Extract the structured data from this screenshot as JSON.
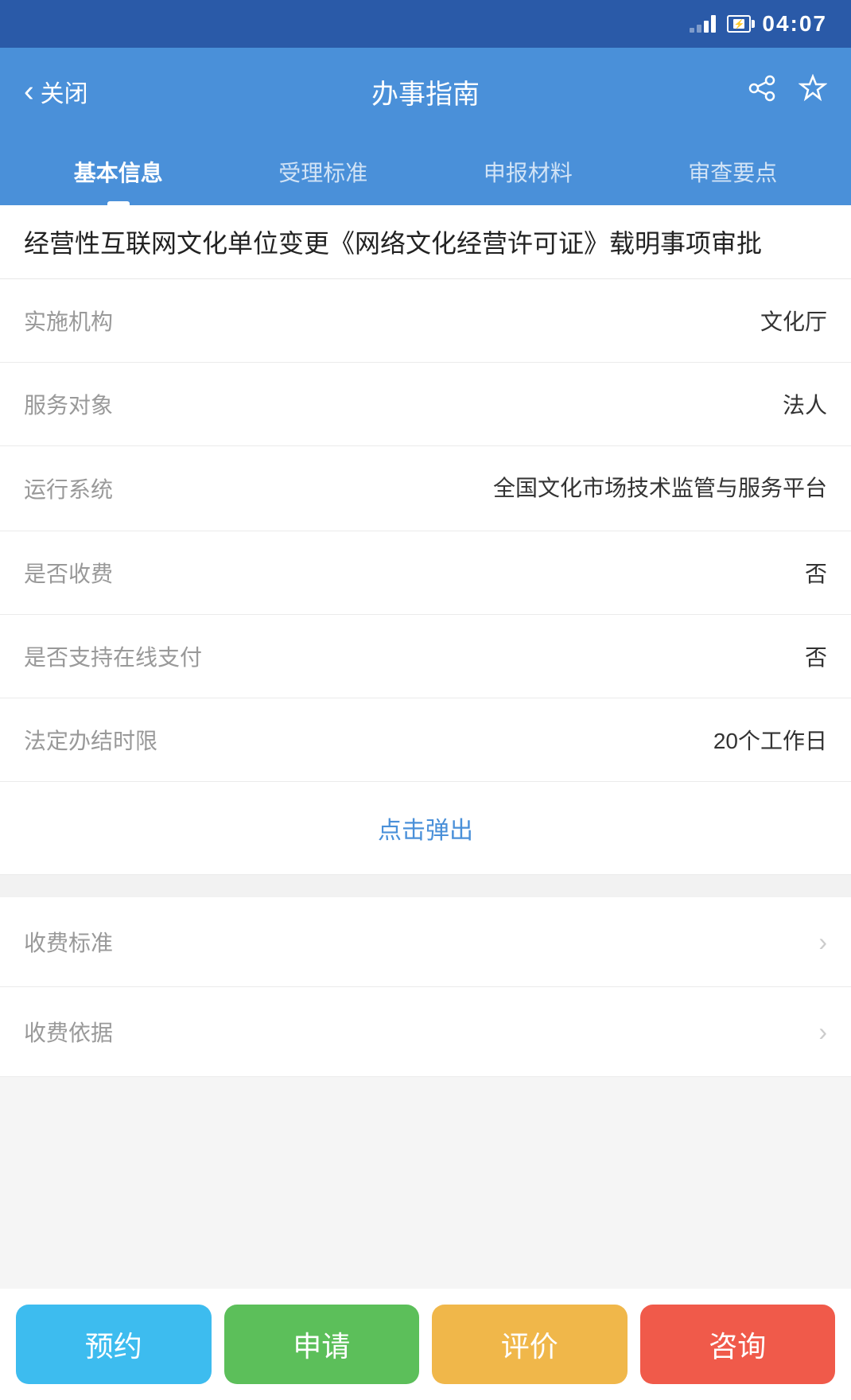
{
  "statusBar": {
    "time": "04:07"
  },
  "navBar": {
    "backLabel": "关闭",
    "title": "办事指南",
    "shareIcon": "share-icon",
    "favoriteIcon": "favorite-icon"
  },
  "tabs": [
    {
      "id": "basic",
      "label": "基本信息",
      "active": true
    },
    {
      "id": "standards",
      "label": "受理标准",
      "active": false
    },
    {
      "id": "materials",
      "label": "申报材料",
      "active": false
    },
    {
      "id": "review",
      "label": "审查要点",
      "active": false
    }
  ],
  "pageTitle": "经营性互联网文化单位变更《网络文化经营许可证》载明事项审批",
  "infoRows": [
    {
      "label": "实施机构",
      "value": "文化厅",
      "multiline": false
    },
    {
      "label": "服务对象",
      "value": "法人",
      "multiline": false
    },
    {
      "label": "运行系统",
      "value": "全国文化市场技术监管与服务平台",
      "multiline": true
    },
    {
      "label": "是否收费",
      "value": "否",
      "multiline": false
    },
    {
      "label": "是否支持在线支付",
      "value": "否",
      "multiline": false
    },
    {
      "label": "法定办结时限",
      "value": "20个工作日",
      "multiline": false
    }
  ],
  "popupText": "点击弹出",
  "menuRows": [
    {
      "label": "收费标准"
    },
    {
      "label": "收费依据"
    }
  ],
  "bottomActions": [
    {
      "id": "reserve",
      "label": "预约",
      "colorClass": "btn-blue"
    },
    {
      "id": "apply",
      "label": "申请",
      "colorClass": "btn-green"
    },
    {
      "id": "evaluate",
      "label": "评价",
      "colorClass": "btn-orange"
    },
    {
      "id": "consult",
      "label": "咨询",
      "colorClass": "btn-red"
    }
  ]
}
